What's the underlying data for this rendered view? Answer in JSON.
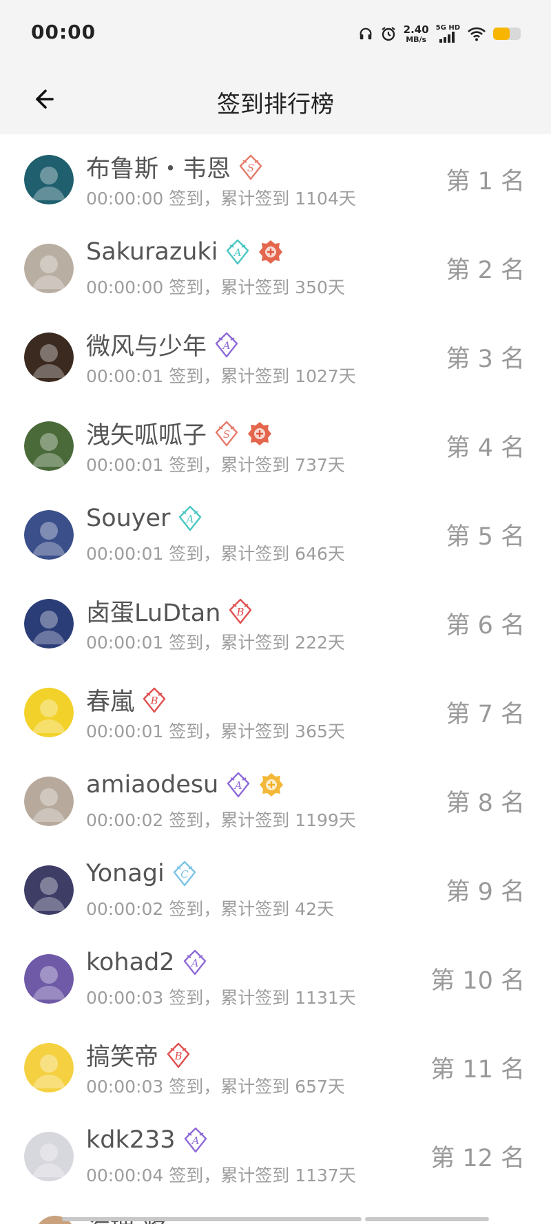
{
  "status_bar": {
    "time": "00:00",
    "net_speed_value": "2.40",
    "net_speed_unit": "MB/s",
    "signal_label": "5G HD",
    "battery_level_fraction": 0.6,
    "battery_color": "#f7b500",
    "icons": [
      "headphones-icon",
      "alarm-icon",
      "signal-icon",
      "wifi-icon",
      "battery-icon"
    ]
  },
  "app_bar": {
    "title": "签到排行榜",
    "back_icon": "arrow-left-icon"
  },
  "rows": [
    {
      "name": "布鲁斯・韦恩",
      "info": "00:00:00 签到，累计签到 1104天",
      "rank": "第 1 名",
      "badges": [
        "S"
      ],
      "avatar_color": "#1f5f6e"
    },
    {
      "name": "Sakurazuki",
      "info": "00:00:00 签到，累计签到 350天",
      "rank": "第 2 名",
      "badges": [
        "A",
        "crest-red"
      ],
      "avatar_color": "#b9aea2"
    },
    {
      "name": "微风与少年",
      "info": "00:00:01 签到，累计签到 1027天",
      "rank": "第 3 名",
      "badges": [
        "A-purple"
      ],
      "avatar_color": "#3a2a20"
    },
    {
      "name": "洩矢呱呱子",
      "info": "00:00:01 签到，累计签到 737天",
      "rank": "第 4 名",
      "badges": [
        "S",
        "crest-red"
      ],
      "avatar_color": "#4a6a3a"
    },
    {
      "name": "Souyer",
      "info": "00:00:01 签到，累计签到 646天",
      "rank": "第 5 名",
      "badges": [
        "A"
      ],
      "avatar_color": "#3b4f8a"
    },
    {
      "name": "卤蛋LuDtan",
      "info": "00:00:01 签到，累计签到 222天",
      "rank": "第 6 名",
      "badges": [
        "B"
      ],
      "avatar_color": "#2b3d77"
    },
    {
      "name": "春嵐",
      "info": "00:00:01 签到，累计签到 365天",
      "rank": "第 7 名",
      "badges": [
        "B"
      ],
      "avatar_color": "#f2d12a"
    },
    {
      "name": "amiaodesu",
      "info": "00:00:02 签到，累计签到 1199天",
      "rank": "第 8 名",
      "badges": [
        "A-purple",
        "crest-gold"
      ],
      "avatar_color": "#b7aa9c"
    },
    {
      "name": "Yonagi",
      "info": "00:00:02 签到，累计签到 42天",
      "rank": "第 9 名",
      "badges": [
        "C"
      ],
      "avatar_color": "#3d3d66"
    },
    {
      "name": "kohad2",
      "info": "00:00:03 签到，累计签到 1131天",
      "rank": "第 10 名",
      "badges": [
        "A-purple"
      ],
      "avatar_color": "#6e5aa6"
    },
    {
      "name": "搞笑帝",
      "info": "00:00:03 签到，累计签到 657天",
      "rank": "第 11 名",
      "badges": [
        "B"
      ],
      "avatar_color": "#f5d142"
    },
    {
      "name": "kdk233",
      "info": "00:00:04 签到，累计签到 1137天",
      "rank": "第 12 名",
      "badges": [
        "A-purple"
      ],
      "avatar_color": "#d7d7de"
    }
  ],
  "partial_row": {
    "name": "海瑞·浆"
  },
  "badge_colors": {
    "S": "#e57b6b",
    "A": "#49c7c2",
    "A-purple": "#8e6ad8",
    "B": "#e04e4e",
    "C": "#7cc3e6",
    "crest-red": "#e0553a",
    "crest-gold": "#f2b024"
  }
}
